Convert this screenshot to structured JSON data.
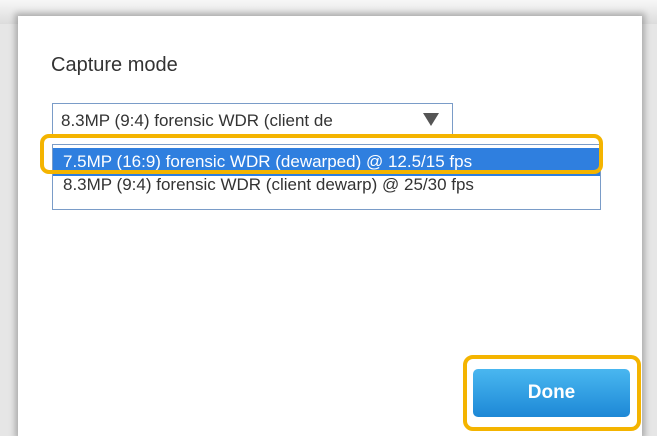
{
  "dialog": {
    "title": "Capture mode",
    "select": {
      "selected_value": "8.3MP (9:4) forensic WDR (client de",
      "arrow_icon": "triangle-down-icon"
    },
    "options": [
      {
        "label": "7.5MP (16:9) forensic WDR (dewarped) @ 12.5/15 fps",
        "highlighted": true
      },
      {
        "label": "8.3MP (9:4) forensic WDR (client dewarp) @ 25/30 fps",
        "highlighted": false
      }
    ],
    "done_label": "Done"
  },
  "colors": {
    "highlight_callout": "#f4b400",
    "option_selected_bg": "#2f7fdf",
    "done_button": "#2a97e0"
  }
}
